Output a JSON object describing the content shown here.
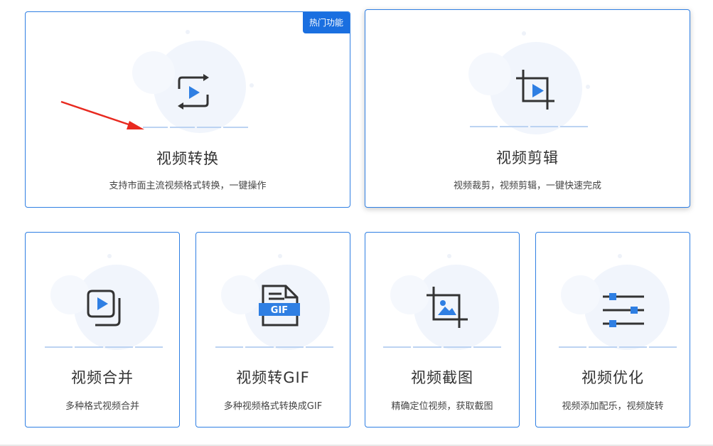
{
  "cards": [
    {
      "title": "视频转换",
      "desc": "支持市面主流视频格式转换，一键操作",
      "badge": "热门功能",
      "icon": "video-convert-icon"
    },
    {
      "title": "视频剪辑",
      "desc": "视频裁剪，视频剪辑，一键快速完成",
      "icon": "crop-video-icon"
    },
    {
      "title": "视频合并",
      "desc": "多种格式视频合并",
      "icon": "video-merge-icon"
    },
    {
      "title": "视频转GIF",
      "desc": "多种视频格式转换成GIF",
      "icon": "gif-file-icon",
      "icon_text": "GIF"
    },
    {
      "title": "视频截图",
      "desc": "精确定位视频，获取截图",
      "icon": "crop-image-icon"
    },
    {
      "title": "视频优化",
      "desc": "视频添加配乐，视频旋转",
      "icon": "sliders-icon"
    }
  ],
  "colors": {
    "accent": "#2f7fe3",
    "icon_blue": "#2f7fe3",
    "icon_dark": "#333333",
    "annotation": "#e8291f"
  }
}
